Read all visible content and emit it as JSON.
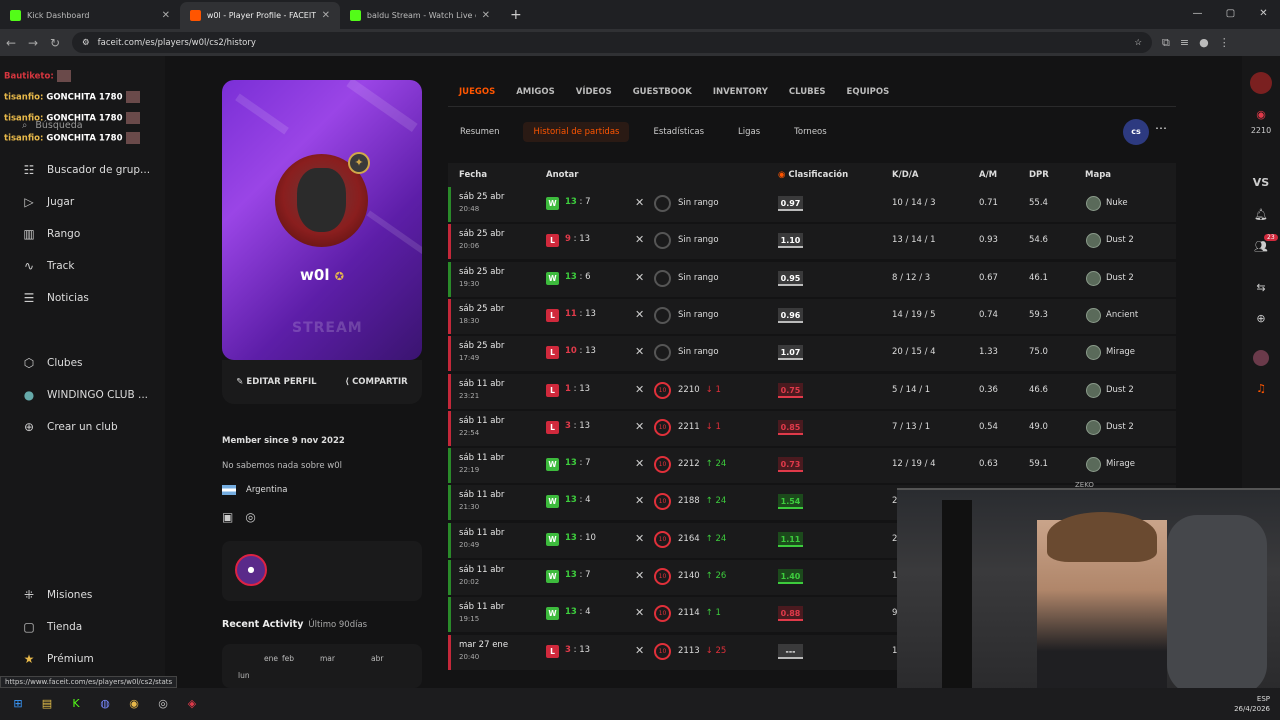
{
  "browser": {
    "tabs": [
      {
        "label": "Kick Dashboard",
        "color": "#53fc18"
      },
      {
        "label": "w0l - Player Profile - FACEIT.com",
        "color": "#ff5500"
      },
      {
        "label": "baldu Stream - Watch Live on Kick",
        "color": "#53fc18"
      }
    ],
    "url": "faceit.com/es/players/w0l/cs2/history",
    "status_url": "https://www.faceit.com/es/players/w0l/cs2/stats"
  },
  "sidebar": {
    "search": "Búsqueda",
    "items": [
      {
        "label": "Buscador de grup...",
        "icon": "search-users-icon",
        "glyph": "☷"
      },
      {
        "label": "Jugar",
        "icon": "play-icon",
        "glyph": "▷"
      },
      {
        "label": "Rango",
        "icon": "ranking-icon",
        "glyph": "▥"
      },
      {
        "label": "Track",
        "icon": "track-icon",
        "glyph": "∿"
      },
      {
        "label": "Noticias",
        "icon": "news-icon",
        "glyph": "☰"
      },
      {
        "label": "Clubes",
        "icon": "clubs-icon",
        "glyph": "⬡"
      },
      {
        "label": "WINDINGO CLUB ...",
        "icon": "club-avatar-icon",
        "glyph": "●"
      },
      {
        "label": "Crear un club",
        "icon": "plus-icon",
        "glyph": "⊕"
      },
      {
        "label": "Misiones",
        "icon": "missions-icon",
        "glyph": "⁜"
      },
      {
        "label": "Tienda",
        "icon": "shop-icon",
        "glyph": "▢"
      },
      {
        "label": "Prémium",
        "icon": "premium-icon",
        "glyph": "★"
      }
    ]
  },
  "chat": [
    {
      "name": "Bautiketo:",
      "msg": ""
    },
    {
      "name": "tisanfio:",
      "msg": "GONCHITA 1780"
    },
    {
      "name": "tisanfio:",
      "msg": "GONCHITA 1780"
    },
    {
      "name": "tisanfio:",
      "msg": "GONCHITA 1780"
    }
  ],
  "profile": {
    "name": "w0l",
    "edit": "EDITAR PERFIL",
    "share": "COMPARTIR",
    "member_since": "Member since 9 nov 2022",
    "about": "No sabemos nada sobre w0l",
    "country": "Argentina",
    "recent_title": "Recent Activity",
    "recent_range": "Último 90días",
    "months": [
      "ene",
      "feb",
      "mar",
      "abr"
    ],
    "day": "lun"
  },
  "tabs": [
    "JUEGOS",
    "AMIGOS",
    "VÍDEOS",
    "GUESTBOOK",
    "INVENTORY",
    "CLUBES",
    "EQUIPOS"
  ],
  "subtabs": [
    "Resumen",
    "Historial de partidas",
    "Estadísticas",
    "Ligas",
    "Torneos"
  ],
  "cs_label": "cs",
  "right_elo": "2210",
  "right_vs": "VS",
  "notif_count": "23",
  "headers": {
    "fecha": "Fecha",
    "anotar": "Anotar",
    "clasif": "Clasificación",
    "kda": "K/D/A",
    "am": "A/M",
    "dpr": "DPR",
    "mapa": "Mapa"
  },
  "rows": [
    {
      "d": "sáb 25 abr",
      "t": "20:48",
      "res": "W",
      "a": "13",
      "b": "7",
      "elo": "Sin rango",
      "chg": "",
      "rate": "0.97",
      "kda": "10 / 14 / 3",
      "am": "0.71",
      "dpr": "55.4",
      "map": "Nuke"
    },
    {
      "d": "sáb 25 abr",
      "t": "20:06",
      "res": "L",
      "a": "9",
      "b": "13",
      "elo": "Sin rango",
      "chg": "",
      "rate": "1.10",
      "kda": "13 / 14 / 1",
      "am": "0.93",
      "dpr": "54.6",
      "map": "Dust 2"
    },
    {
      "d": "sáb 25 abr",
      "t": "19:30",
      "res": "W",
      "a": "13",
      "b": "6",
      "elo": "Sin rango",
      "chg": "",
      "rate": "0.95",
      "kda": "8 / 12 / 3",
      "am": "0.67",
      "dpr": "46.1",
      "map": "Dust 2"
    },
    {
      "d": "sáb 25 abr",
      "t": "18:30",
      "res": "L",
      "a": "11",
      "b": "13",
      "elo": "Sin rango",
      "chg": "",
      "rate": "0.96",
      "kda": "14 / 19 / 5",
      "am": "0.74",
      "dpr": "59.3",
      "map": "Ancient"
    },
    {
      "d": "sáb 25 abr",
      "t": "17:49",
      "res": "L",
      "a": "10",
      "b": "13",
      "elo": "Sin rango",
      "chg": "",
      "rate": "1.07",
      "kda": "20 / 15 / 4",
      "am": "1.33",
      "dpr": "75.0",
      "map": "Mirage"
    },
    {
      "d": "sáb 11 abr",
      "t": "23:21",
      "res": "L",
      "a": "1",
      "b": "13",
      "elo": "2210",
      "chg": "↓ 1",
      "rate": "0.75",
      "kda": "5 / 14 / 1",
      "am": "0.36",
      "dpr": "46.6",
      "map": "Dust 2"
    },
    {
      "d": "sáb 11 abr",
      "t": "22:54",
      "res": "L",
      "a": "3",
      "b": "13",
      "elo": "2211",
      "chg": "↓ 1",
      "rate": "0.85",
      "kda": "7 / 13 / 1",
      "am": "0.54",
      "dpr": "49.0",
      "map": "Dust 2"
    },
    {
      "d": "sáb 11 abr",
      "t": "22:19",
      "res": "W",
      "a": "13",
      "b": "7",
      "elo": "2212",
      "chg": "↑ 24",
      "rate": "0.73",
      "kda": "12 / 19 / 4",
      "am": "0.63",
      "dpr": "59.1",
      "map": "Mirage"
    },
    {
      "d": "sáb 11 abr",
      "t": "21:30",
      "res": "W",
      "a": "13",
      "b": "4",
      "elo": "2188",
      "chg": "↑ 24",
      "rate": "1.54",
      "kda": "2",
      "am": "",
      "dpr": "",
      "map": ""
    },
    {
      "d": "sáb 11 abr",
      "t": "20:49",
      "res": "W",
      "a": "13",
      "b": "10",
      "elo": "2164",
      "chg": "↑ 24",
      "rate": "1.11",
      "kda": "2",
      "am": "",
      "dpr": "",
      "map": ""
    },
    {
      "d": "sáb 11 abr",
      "t": "20:02",
      "res": "W",
      "a": "13",
      "b": "7",
      "elo": "2140",
      "chg": "↑ 26",
      "rate": "1.40",
      "kda": "1",
      "am": "",
      "dpr": "",
      "map": ""
    },
    {
      "d": "sáb 11 abr",
      "t": "19:15",
      "res": "W",
      "a": "13",
      "b": "4",
      "elo": "2114",
      "chg": "↑ 1",
      "rate": "0.88",
      "kda": "9",
      "am": "",
      "dpr": "",
      "map": ""
    },
    {
      "d": "mar 27 ene",
      "t": "20:40",
      "res": "L",
      "a": "3",
      "b": "13",
      "elo": "2113",
      "chg": "↓ 25",
      "rate": "---",
      "kda": "1",
      "am": "",
      "dpr": "",
      "map": ""
    }
  ],
  "zeko": "ZEKO",
  "clock": {
    "time": "",
    "date": "26/4/2026"
  },
  "lang": "ESP"
}
